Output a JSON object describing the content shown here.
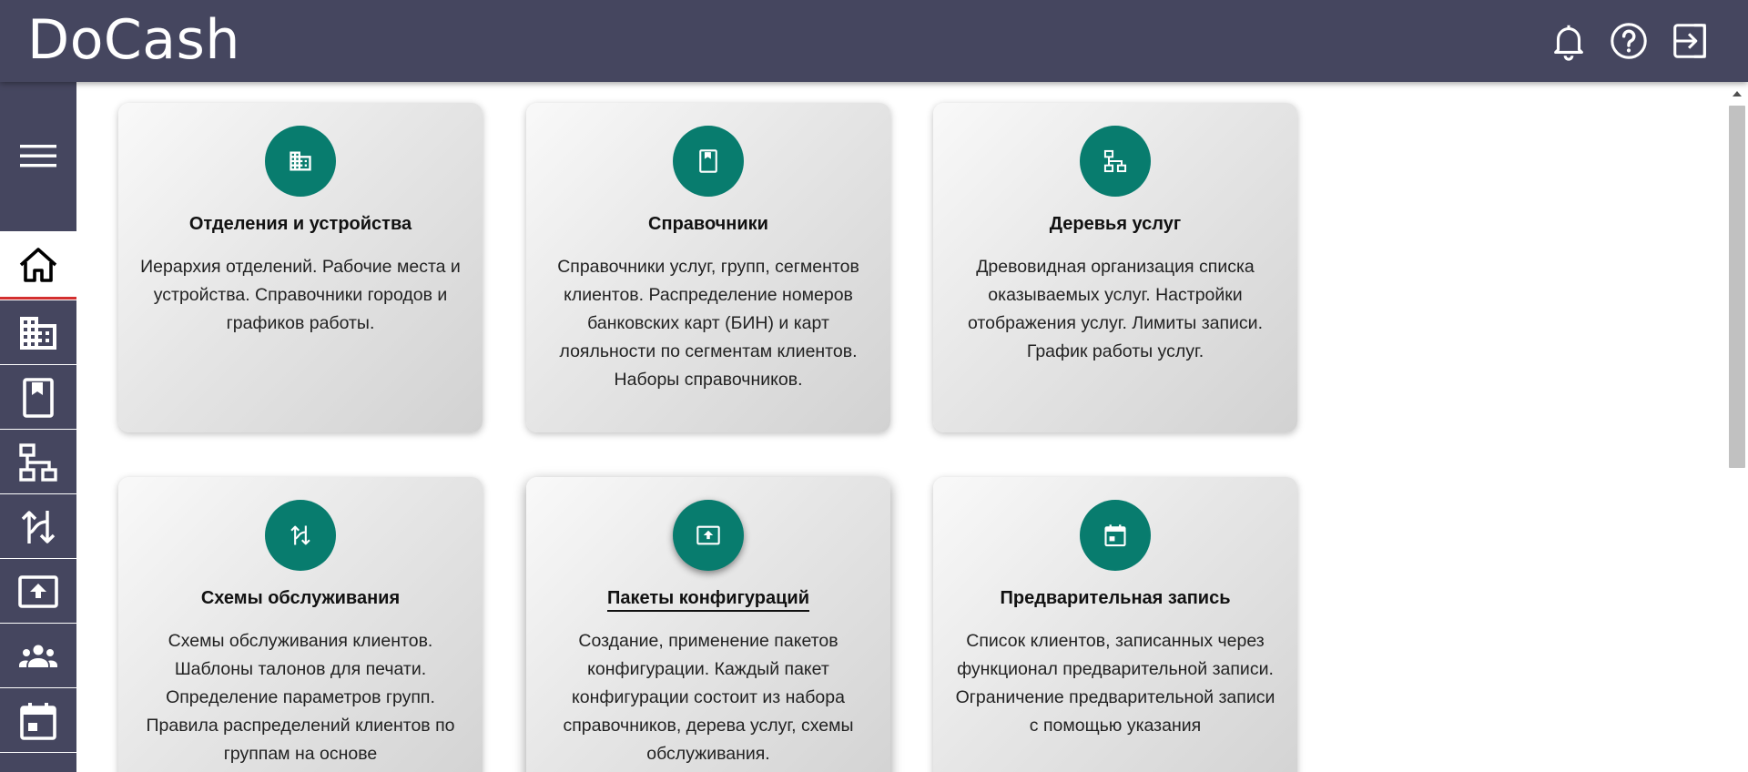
{
  "header": {
    "logo": "DoCash",
    "icons": [
      "bell-icon",
      "help-icon",
      "logout-icon"
    ]
  },
  "sidebar": {
    "menu_icon": "hamburger-icon",
    "items": [
      "home-icon",
      "building-icon",
      "book-icon",
      "hierarchy-icon",
      "swap-icon",
      "upload-icon",
      "users-icon",
      "calendar-icon"
    ],
    "active_item": "home-icon"
  },
  "cards": [
    {
      "title": "Отделения и устройства",
      "icon": "building-icon",
      "desc": "Иерархия отделений. Рабочие места и устройства. Справочники городов и графиков работы."
    },
    {
      "title": "Справочники",
      "icon": "book-icon",
      "desc": "Справочники услуг, групп, сегментов клиентов. Распределение номеров банковских карт (БИН) и карт лояльности по сегментам клиентов. Наборы справочников."
    },
    {
      "title": "Деревья услуг",
      "icon": "hierarchy-icon",
      "desc": "Древовидная организация списка оказываемых услуг. Настройки отображения услуг. Лимиты записи. График работы услуг."
    },
    {
      "title": "Схемы обслуживания",
      "icon": "swap-icon",
      "desc": "Схемы обслуживания клиентов. Шаблоны талонов для печати. Определение параметров групп. Правила распределений клиентов по группам на основе"
    },
    {
      "title": "Пакеты конфигураций",
      "icon": "upload-icon",
      "desc": "Создание, применение пакетов конфигурации. Каждый пакет конфигурации состоит из набора справочников, дерева услуг, схемы обслуживания."
    },
    {
      "title": "Предварительная запись",
      "icon": "calendar-icon",
      "desc": "Список клиентов, записанных через функционал предварительной записи. Ограничение предварительной записи с помощью указания"
    }
  ],
  "colors": {
    "header_bg": "#45465f",
    "accent": "#087c6e",
    "active_indicator": "#d32f2f"
  }
}
